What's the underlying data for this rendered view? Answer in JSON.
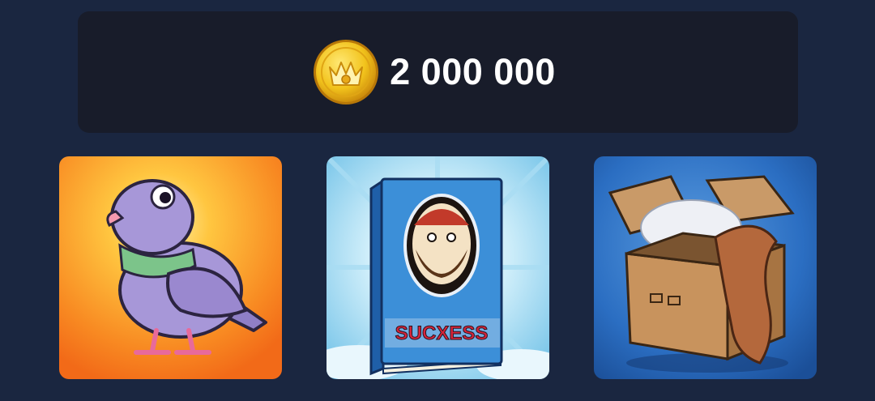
{
  "balance": {
    "amount": "2 000 000",
    "currency_icon": "gold-crown-coin-icon",
    "coin_color": "#f1c21b"
  },
  "cards": [
    {
      "id": "pigeon",
      "icon": "pigeon-icon"
    },
    {
      "id": "book",
      "icon": "book-icon",
      "cover_text": "SUCXESS"
    },
    {
      "id": "cardboard-box",
      "icon": "cardboard-box-icon"
    }
  ],
  "colors": {
    "background": "#1a2640",
    "panel": "#181c2a",
    "text": "#ffffff"
  }
}
